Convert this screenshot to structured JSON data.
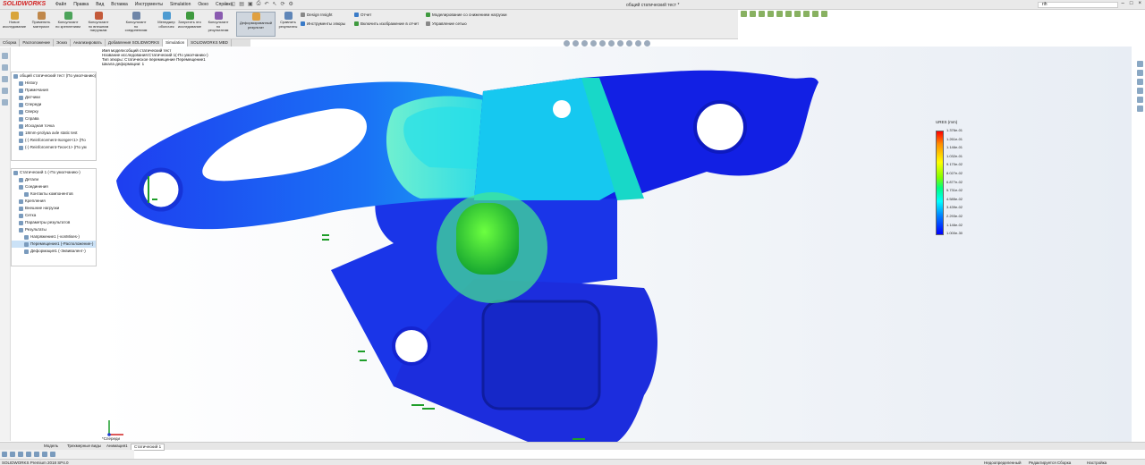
{
  "app": {
    "logo": "SOLIDWORKS",
    "window_title": "общий статический тест *",
    "search_value": "rih"
  },
  "menu": [
    "Файл",
    "Правка",
    "Вид",
    "Вставка",
    "Инструменты",
    "Simulation",
    "Окно",
    "Справка"
  ],
  "ribbon": {
    "buttons": [
      "Новое исследование",
      "Применить материал",
      "Консультант по креплениям",
      "Консультант по внешним нагрузкам",
      "Консультант по соединениям",
      "Менеджер оболочек",
      "Запустить это исследование",
      "Консультант по результатам",
      "Деформированный результат",
      "Сравнить результаты"
    ],
    "small": [
      "Design Insight",
      "Инструменты эпюры",
      "Отчет",
      "Включить изображение в отчет",
      "Моделирование со снижением нагрузки",
      "Управление сетью"
    ]
  },
  "feature_tabs": [
    "Сборка",
    "Расположение",
    "Эскиз",
    "Анализировать",
    "Добавления SOLIDWORKS",
    "Simulation",
    "SOLIDWORKS MBD"
  ],
  "tree1": [
    "общий статический тест (По умолчанию)",
    "History",
    "Примечания",
    "Датчики",
    "Спереди",
    "Сверху",
    "Справа",
    "Исходная точка",
    "18mm-prolyaa axle static test",
    "(-) Reinforcement-Isonger<1> (По",
    "(-) Reinforcement-Тиск<1> (По ум"
  ],
  "tree2": [
    "Статический 1 (-По умолчанию-)",
    "Детали",
    "Соединения",
    "Контакты компонентов",
    "Крепления",
    "Внешние нагрузки",
    "Сетка",
    "Параметры результатов",
    "Результаты",
    "Напряжение1 (-vonMises-)",
    "Перемещение1 (-Расположение-)",
    "Деформация1 (-Эквивалент-)"
  ],
  "viewport_info": [
    "Имя модели:общий статический тест",
    "Название исследования:Статический 1(-По умолчанию-)",
    "Тип эпюры: Статическое перемещение Перемещение1",
    "Шкала деформации: 1"
  ],
  "legend": {
    "title": "URES (mm)",
    "labels": [
      "1.376e-01",
      "1.261e-01",
      "1.146e-01",
      "1.032e-01",
      "9.170e-02",
      "8.027e-02",
      "6.877e-02",
      "5.731e-02",
      "4.585e-02",
      "3.439e-02",
      "2.293e-02",
      "1.146e-02",
      "1.000e-30"
    ]
  },
  "triad_label": "*Спереди",
  "bottom_tabs": [
    "Модель",
    "Трехмерные виды",
    "Анимация1",
    "Статический 1"
  ],
  "status": {
    "left": "SOLIDWORKS Premium 2018 SP4.0",
    "defined": "Недоопределенный",
    "editing": "Редактируется Сборка",
    "mmgs": "Настройка"
  }
}
